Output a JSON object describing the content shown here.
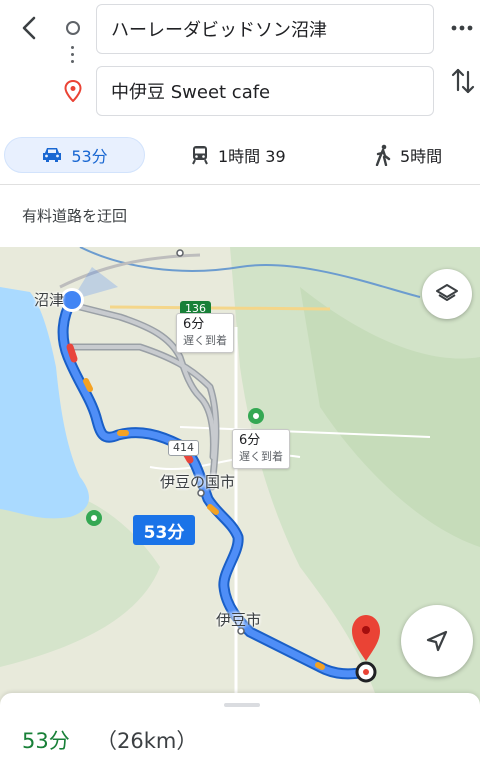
{
  "search": {
    "origin": "ハーレーダビッドソン沼津",
    "destination": "中伊豆 Sweet cafe"
  },
  "modes": {
    "drive_label": "53分",
    "transit_label": "1時間 39",
    "walk_label": "5時間"
  },
  "route_note": "有料道路を迂回",
  "map": {
    "places": {
      "numazu": "沼津",
      "izunokuni": "伊豆の国市",
      "izu": "伊豆市"
    },
    "roads": {
      "route136": "136",
      "route414": "414"
    },
    "alt_route_1": {
      "time": "6分",
      "note": "遅く到着"
    },
    "alt_route_2": {
      "time": "6分",
      "note": "遅く到着"
    },
    "route_duration": "53分"
  },
  "summary": {
    "time": "53分",
    "distance": "（26km）"
  },
  "colors": {
    "accent": "#1a73e8",
    "duration_green": "#188038",
    "destination_pin": "#ea4335"
  },
  "icons": [
    "back-arrow-icon",
    "origin-circle-icon",
    "destination-pin-icon",
    "more-vert-icon",
    "swap-icon",
    "car-icon",
    "train-icon",
    "walk-icon",
    "layers-icon",
    "navigation-arrow-icon"
  ]
}
